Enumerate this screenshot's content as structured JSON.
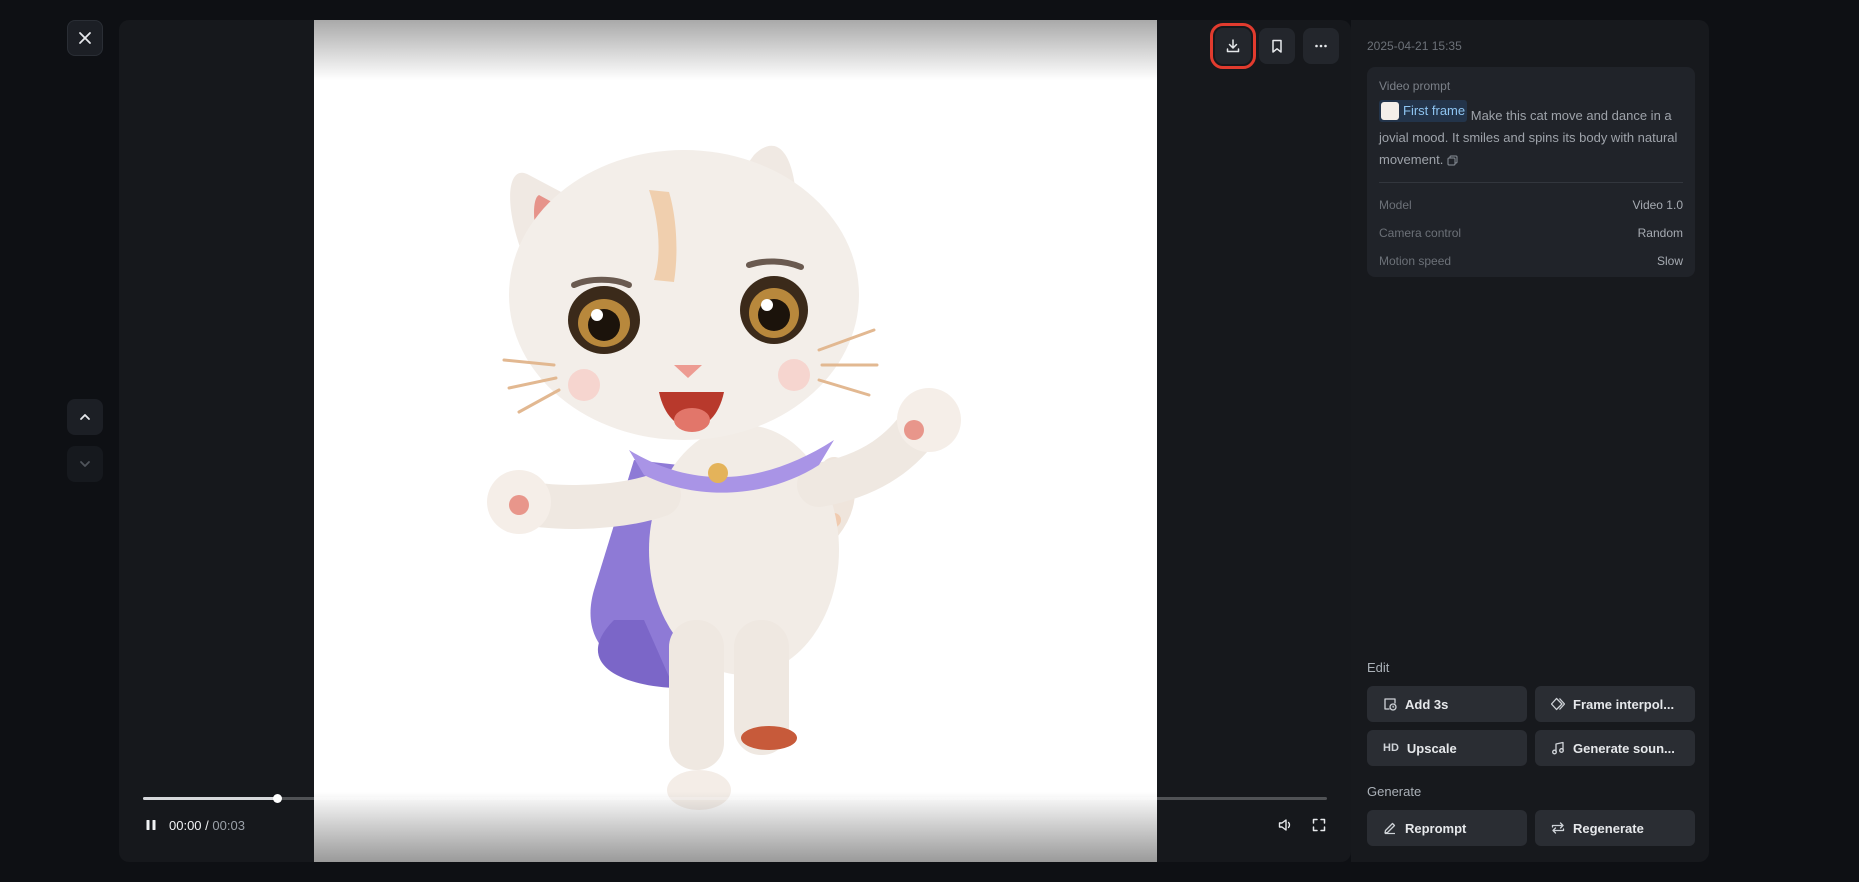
{
  "player": {
    "time_current": "00:00",
    "time_separator": "/",
    "time_total": "00:03",
    "progress_fraction": 0.113
  },
  "panel": {
    "timestamp": "2025-04-21 15:35",
    "prompt_label": "Video prompt",
    "first_frame_label": "First frame",
    "prompt_text": "Make this cat move and dance in a jovial mood. It smiles and spins its body with natural movement.",
    "details": [
      {
        "key": "Model",
        "value": "Video 1.0"
      },
      {
        "key": "Camera control",
        "value": "Random"
      },
      {
        "key": "Motion speed",
        "value": "Slow"
      }
    ],
    "edit_title": "Edit",
    "edit_buttons": {
      "add": "Add 3s",
      "frame": "Frame interpol...",
      "upscale": "Upscale",
      "upscale_glyph": "HD",
      "sound": "Generate soun..."
    },
    "generate_title": "Generate",
    "generate_buttons": {
      "reprompt": "Reprompt",
      "regenerate": "Regenerate"
    }
  },
  "icons": {
    "close": "close-icon",
    "nav_up": "chevron-up-icon",
    "nav_down": "chevron-down-icon",
    "download": "download-icon",
    "bookmark": "bookmark-icon",
    "more": "more-icon",
    "pause": "pause-icon",
    "volume": "volume-icon",
    "fullscreen": "fullscreen-icon",
    "copy": "copy-icon"
  },
  "colors": {
    "highlight": "#e23b2e",
    "chip_bg": "#23344a",
    "chip_text": "#8ec4f0",
    "cape": "#8e7ad6"
  }
}
